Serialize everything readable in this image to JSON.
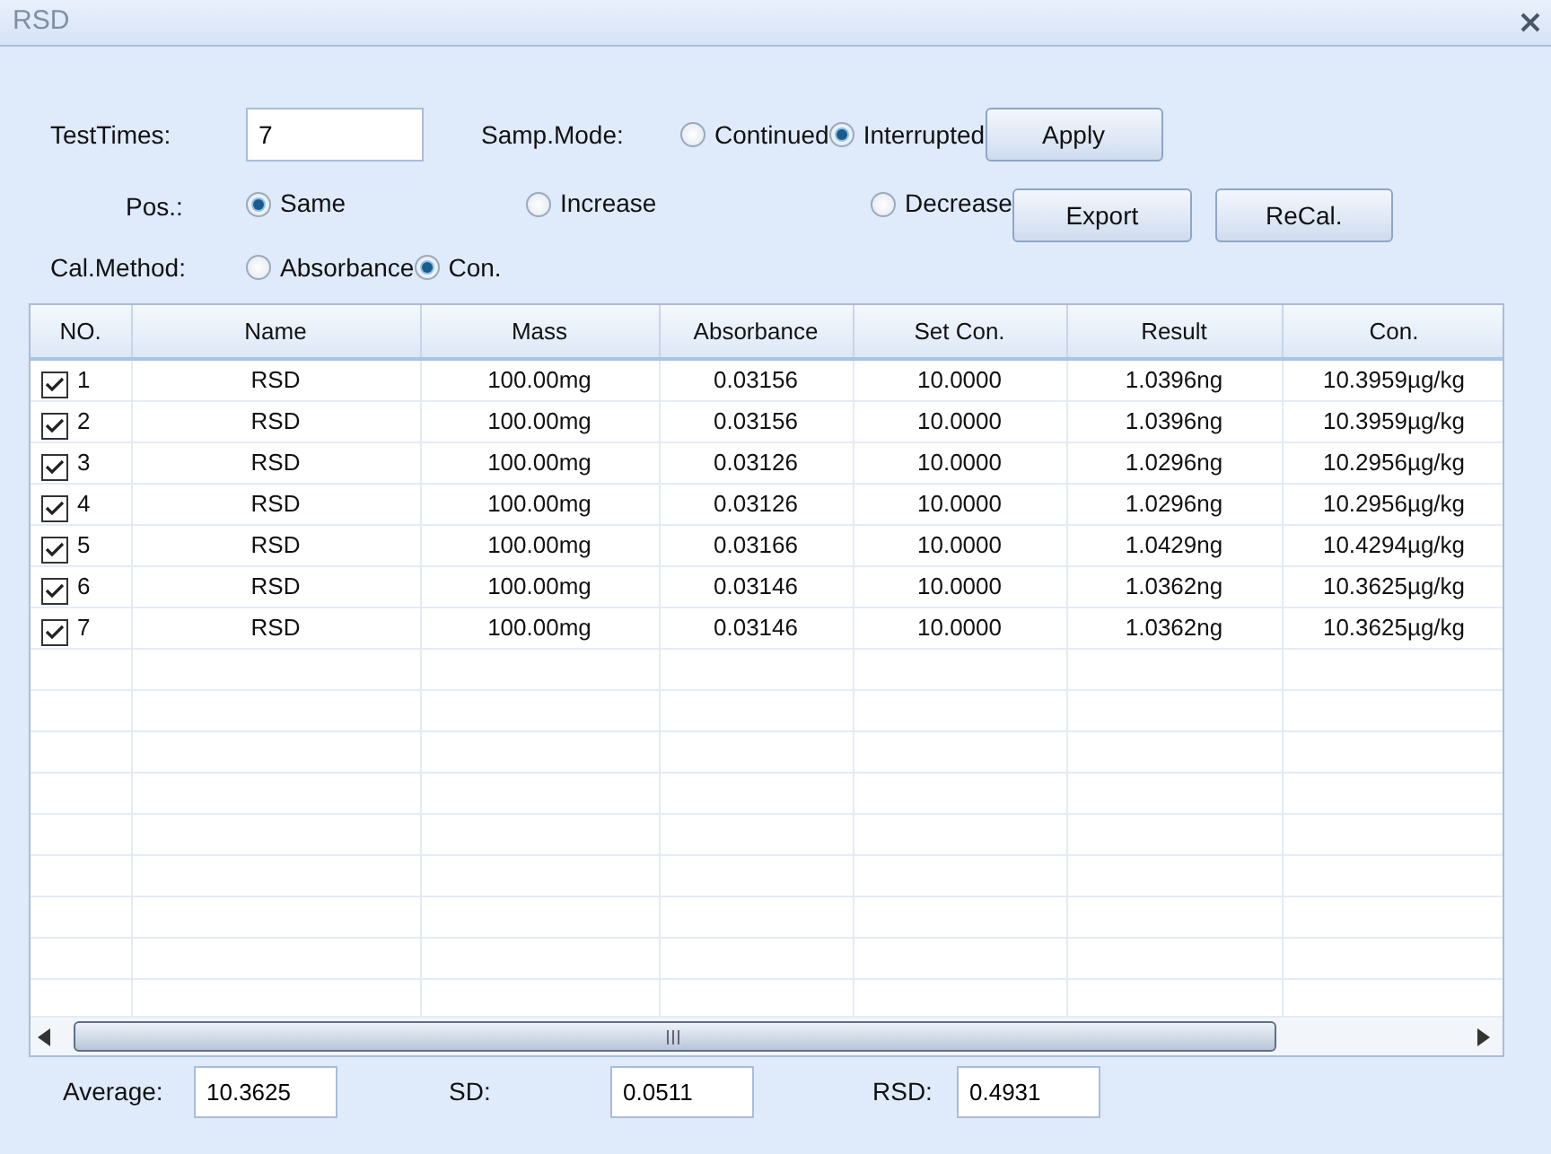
{
  "window": {
    "title": "RSD"
  },
  "test_times": {
    "label": "TestTimes:",
    "value": "7"
  },
  "samp_mode": {
    "label": "Samp.Mode:",
    "options": [
      {
        "label": "Continued",
        "selected": false
      },
      {
        "label": "Interrupted",
        "selected": true
      }
    ]
  },
  "pos": {
    "label": "Pos.:",
    "options": [
      {
        "label": "Same",
        "selected": true
      },
      {
        "label": "Increase",
        "selected": false
      },
      {
        "label": "Decrease",
        "selected": false
      }
    ]
  },
  "cal_method": {
    "label": "Cal.Method:",
    "options": [
      {
        "label": "Absorbance",
        "selected": false
      },
      {
        "label": "Con.",
        "selected": true
      }
    ]
  },
  "buttons": {
    "apply": "Apply",
    "export": "Export",
    "recal": "ReCal."
  },
  "table": {
    "columns": [
      "NO.",
      "Name",
      "Mass",
      "Absorbance",
      "Set Con.",
      "Result",
      "Con."
    ],
    "rows": [
      {
        "checked": true,
        "cells": [
          "1",
          "RSD",
          "100.00mg",
          "0.03156",
          "10.0000",
          "1.0396ng",
          "10.3959µg/kg"
        ]
      },
      {
        "checked": true,
        "cells": [
          "2",
          "RSD",
          "100.00mg",
          "0.03156",
          "10.0000",
          "1.0396ng",
          "10.3959µg/kg"
        ]
      },
      {
        "checked": true,
        "cells": [
          "3",
          "RSD",
          "100.00mg",
          "0.03126",
          "10.0000",
          "1.0296ng",
          "10.2956µg/kg"
        ]
      },
      {
        "checked": true,
        "cells": [
          "4",
          "RSD",
          "100.00mg",
          "0.03126",
          "10.0000",
          "1.0296ng",
          "10.2956µg/kg"
        ]
      },
      {
        "checked": true,
        "cells": [
          "5",
          "RSD",
          "100.00mg",
          "0.03166",
          "10.0000",
          "1.0429ng",
          "10.4294µg/kg"
        ]
      },
      {
        "checked": true,
        "cells": [
          "6",
          "RSD",
          "100.00mg",
          "0.03146",
          "10.0000",
          "1.0362ng",
          "10.3625µg/kg"
        ]
      },
      {
        "checked": true,
        "cells": [
          "7",
          "RSD",
          "100.00mg",
          "0.03146",
          "10.0000",
          "1.0362ng",
          "10.3625µg/kg"
        ]
      }
    ]
  },
  "summary": [
    {
      "label": "Average:",
      "value": "10.3625"
    },
    {
      "label": "SD:",
      "value": "0.0511"
    },
    {
      "label": "RSD:",
      "value": "0.4931"
    }
  ]
}
